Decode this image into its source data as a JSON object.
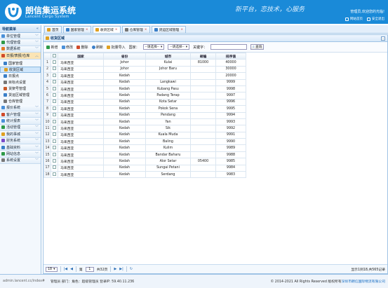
{
  "header": {
    "title": "朗信集运系统",
    "subtitle": "Lancent Cargo System",
    "slogan": "新平台，恋技术，心服务",
    "welcome": "管理员,欢迎您的光临!",
    "link_home": "网站首页",
    "link_logout": "安全退出"
  },
  "sidebar": {
    "title": "导航菜单",
    "groups": [
      {
        "label": "单位管理",
        "color": "#4a90d9"
      },
      {
        "label": "代理管理",
        "color": "#2e9a48"
      },
      {
        "label": "数据系统",
        "color": "#e07a2a"
      },
      {
        "label": "日报/表报/仓库",
        "color": "#d04a2a",
        "active": true
      }
    ],
    "subs": [
      {
        "label": "国家管理",
        "color": "#3a7fc8"
      },
      {
        "label": "收货区域",
        "color": "#e0a020",
        "active": true
      },
      {
        "label": "日报点",
        "color": "#3a7fc8"
      },
      {
        "label": "目标点设置",
        "color": "#777"
      },
      {
        "label": "货架号管理",
        "color": "#c85a2a"
      },
      {
        "label": "货运区域管理",
        "color": "#3a7fc8"
      },
      {
        "label": "仓库管理",
        "color": "#777"
      }
    ],
    "groups2": [
      {
        "label": "报价系统",
        "color": "#4a90d9"
      },
      {
        "label": "客户管理",
        "color": "#d04a2a"
      },
      {
        "label": "统计报表",
        "color": "#4a90d9"
      },
      {
        "label": "活动管理",
        "color": "#2e9a48"
      },
      {
        "label": "我的事城",
        "color": "#e0a020"
      },
      {
        "label": "财务系统",
        "color": "#7a4ac8"
      },
      {
        "label": "基础资料",
        "color": "#3a7fc8"
      },
      {
        "label": "网站信息",
        "color": "#2e9a48"
      },
      {
        "label": "系统设置",
        "color": "#777"
      }
    ]
  },
  "tabs": [
    {
      "label": "首页",
      "color": "#e0a020"
    },
    {
      "label": "国家管理",
      "color": "#3a7fc8"
    },
    {
      "label": "收货区域",
      "color": "#e0a020",
      "active": true
    },
    {
      "label": "仓库管理",
      "color": "#777"
    },
    {
      "label": "货运区域管理",
      "color": "#3a7fc8"
    }
  ],
  "panel_title": "收货区域",
  "toolbar": {
    "add": "新增",
    "edit": "修改",
    "delete": "删除",
    "refresh": "刷新",
    "import": "批量导入",
    "country_label": "国家：",
    "country_placeholder": "--请选择--",
    "state_placeholder": "--请选择--",
    "keyword_label": "关键字：",
    "query": "查询"
  },
  "table": {
    "headers": [
      "国家",
      "省份",
      "城市",
      "邮编",
      "排序值"
    ],
    "rows": [
      [
        "马来西亚",
        "Johor",
        "Kulai",
        "81000",
        "40000"
      ],
      [
        "马来西亚",
        "Johor",
        "Johor Baru",
        "",
        "30000"
      ],
      [
        "马来西亚",
        "Kedah",
        "",
        "",
        "20000"
      ],
      [
        "马来西亚",
        "Kedah",
        "Langkawi",
        "",
        "9999"
      ],
      [
        "马来西亚",
        "Kedah",
        "Kubang Pasu",
        "",
        "9998"
      ],
      [
        "马来西亚",
        "Kedah",
        "Padang Terap",
        "",
        "9997"
      ],
      [
        "马来西亚",
        "Kedah",
        "Kota Setar",
        "",
        "9996"
      ],
      [
        "马来西亚",
        "Kedah",
        "Pokok Sena",
        "",
        "9995"
      ],
      [
        "马来西亚",
        "Kedah",
        "Pendang",
        "",
        "9994"
      ],
      [
        "马来西亚",
        "Kedah",
        "Yan",
        "",
        "9993"
      ],
      [
        "马来西亚",
        "Kedah",
        "Sik",
        "",
        "9992"
      ],
      [
        "马来西亚",
        "Kedah",
        "Kuala Muda",
        "",
        "9991"
      ],
      [
        "马来西亚",
        "Kedah",
        "Baling",
        "",
        "9990"
      ],
      [
        "马来西亚",
        "Kedah",
        "Kulim",
        "",
        "9989"
      ],
      [
        "马来西亚",
        "Kedah",
        "Bandar Baharu",
        "",
        "9988"
      ],
      [
        "马来西亚",
        "Kedah",
        "Alor Setar",
        "05400",
        "9985"
      ],
      [
        "马来西亚",
        "Kedah",
        "Sungai Petani",
        "",
        "9984"
      ],
      [
        "马来西亚",
        "Kedah",
        "Serdang",
        "",
        "9983"
      ]
    ]
  },
  "pager": {
    "page_size": "18",
    "page_prefix": "第",
    "page_value": "1",
    "page_total": "共32页",
    "info": "显示1到18,共565记录"
  },
  "footer": {
    "url": "admin.lancent.cc/index#",
    "user": "管理员 部门：角色：超级管理员 登录IP: 59.40.11.236",
    "copyright": "© 2014-2021 All Rights Reserved 版权所有",
    "company": "深圳市朗信国际物流有限公司"
  }
}
